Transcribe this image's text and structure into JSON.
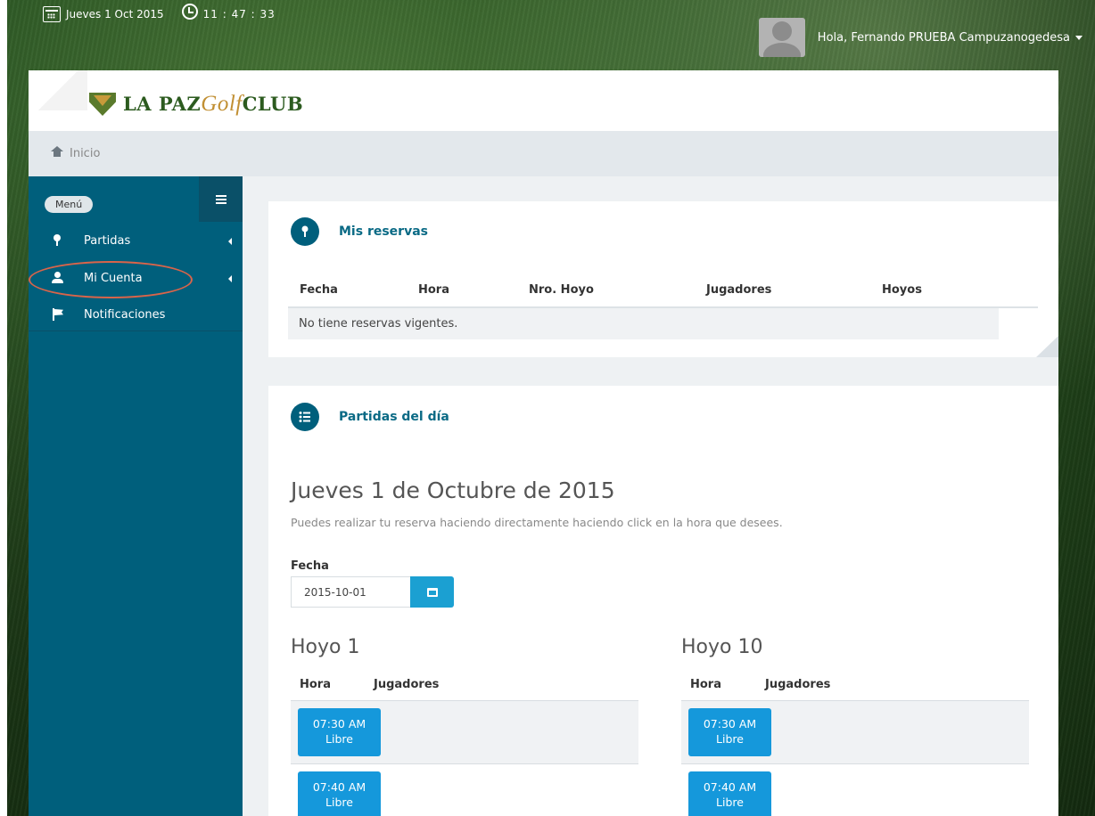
{
  "topbar": {
    "date": "Jueves 1 Oct 2015",
    "time": "11 : 47 : 33",
    "user_greeting": "Hola, Fernando PRUEBA Campuzanogedesa"
  },
  "header": {
    "logo_part1": "LA PAZ",
    "logo_part2": "Golf",
    "logo_part3": "CLUB"
  },
  "breadcrumb": {
    "home": "Inicio"
  },
  "sidebar": {
    "menu_label": "Menú",
    "items": [
      {
        "label": "Partidas",
        "icon": "pin-icon"
      },
      {
        "label": "Mi Cuenta",
        "icon": "user-icon"
      },
      {
        "label": "Notificaciones",
        "icon": "flag-icon"
      }
    ]
  },
  "mis_reservas": {
    "title": "Mis reservas",
    "columns": [
      "Fecha",
      "Hora",
      "Nro. Hoyo",
      "Jugadores",
      "Hoyos"
    ],
    "empty_message": "No tiene reservas vigentes."
  },
  "partidas": {
    "title": "Partidas del día",
    "day_heading": "Jueves 1 de Octubre de 2015",
    "subtitle": "Puedes realizar tu reserva haciendo directamente haciendo click en la hora que desees.",
    "fecha_label": "Fecha",
    "fecha_value": "2015-10-01",
    "hoyos": [
      {
        "title": "Hoyo 1",
        "columns": [
          "Hora",
          "Jugadores"
        ],
        "slots": [
          {
            "time": "07:30 AM",
            "status": "Libre"
          },
          {
            "time": "07:40 AM",
            "status": "Libre"
          }
        ]
      },
      {
        "title": "Hoyo 10",
        "columns": [
          "Hora",
          "Jugadores"
        ],
        "slots": [
          {
            "time": "07:30 AM",
            "status": "Libre"
          },
          {
            "time": "07:40 AM",
            "status": "Libre"
          }
        ]
      }
    ]
  },
  "colors": {
    "sidebar": "#005f7c",
    "accent": "#0a6a85",
    "slot_button": "#1598db",
    "highlight": "#d9644a"
  }
}
